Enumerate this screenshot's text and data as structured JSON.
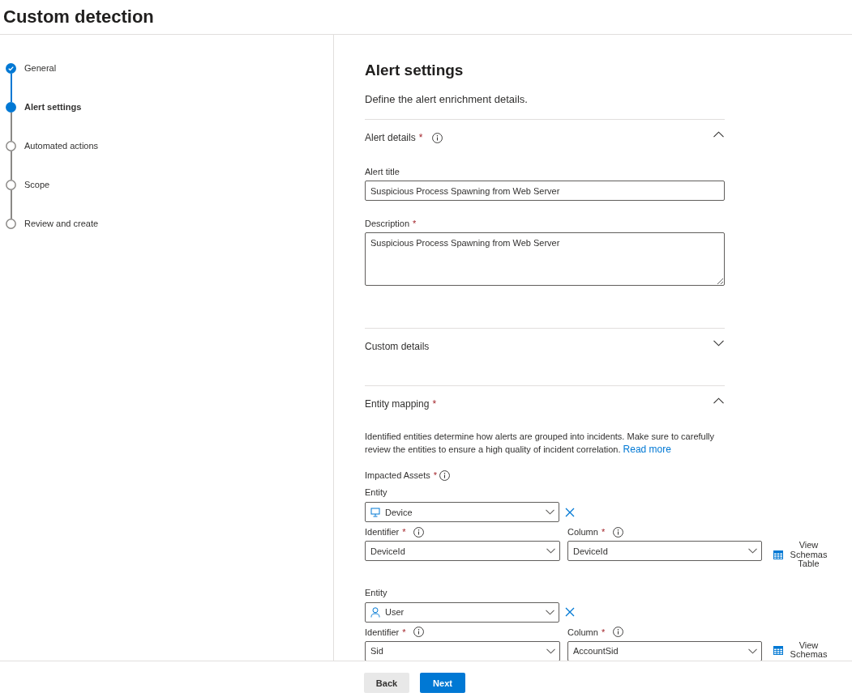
{
  "page": {
    "title": "Custom detection"
  },
  "steps": [
    {
      "label": "General",
      "completed": true,
      "selected": false
    },
    {
      "label": "Alert settings",
      "completed": false,
      "selected": true
    },
    {
      "label": "Automated actions",
      "completed": false,
      "selected": false
    },
    {
      "label": "Scope",
      "completed": false,
      "selected": false
    },
    {
      "label": "Review and create",
      "completed": false,
      "selected": false
    }
  ],
  "content": {
    "title": "Alert settings",
    "subtitle": "Define the alert enrichment details."
  },
  "sections": [
    {
      "kind": "fields",
      "title": "Alert details",
      "required_mark": "*",
      "info": true,
      "expanded": true,
      "fields": [
        {
          "kind": "text",
          "label": "Alert title",
          "value": "Suspicious Process Spawning from Web Server"
        },
        {
          "kind": "textarea",
          "label": "Description",
          "required_mark": "*",
          "value": "Suspicious Process Spawning from Web Server"
        }
      ]
    },
    {
      "title": "Custom details",
      "expanded": false
    },
    {
      "kind": "entities",
      "title": "Entity mapping",
      "required_mark": "*",
      "expanded": true,
      "intro": "Identified entities determine how alerts are grouped into incidents. Make sure to carefully review the entities to ensure a high quality of incident correlation.",
      "link": "Read more",
      "group": {
        "label": "Impacted Assets",
        "required_mark": "*",
        "info": true
      },
      "mappings": [
        {
          "entity": {
            "label": "Entity",
            "kind": "device",
            "value": "Device"
          },
          "identifier": {
            "label": "Identifier",
            "required_mark": "*",
            "info": true,
            "value": "DeviceId"
          },
          "column": {
            "label": "Column",
            "required_mark": "*",
            "info": true,
            "value": "DeviceId"
          },
          "schema_link": "View Schemas Table"
        },
        {
          "entity": {
            "label": "Entity",
            "kind": "user",
            "value": "User"
          },
          "identifier": {
            "label": "Identifier",
            "required_mark": "*",
            "info": true,
            "value": "Sid"
          },
          "column": {
            "label": "Column",
            "required_mark": "*",
            "info": true,
            "value": "AccountSid"
          },
          "schema_link": "View Schemas"
        }
      ]
    }
  ],
  "buttons": [
    {
      "label": "Back",
      "kind": "secondary"
    },
    {
      "label": "Next",
      "kind": "primary"
    }
  ]
}
